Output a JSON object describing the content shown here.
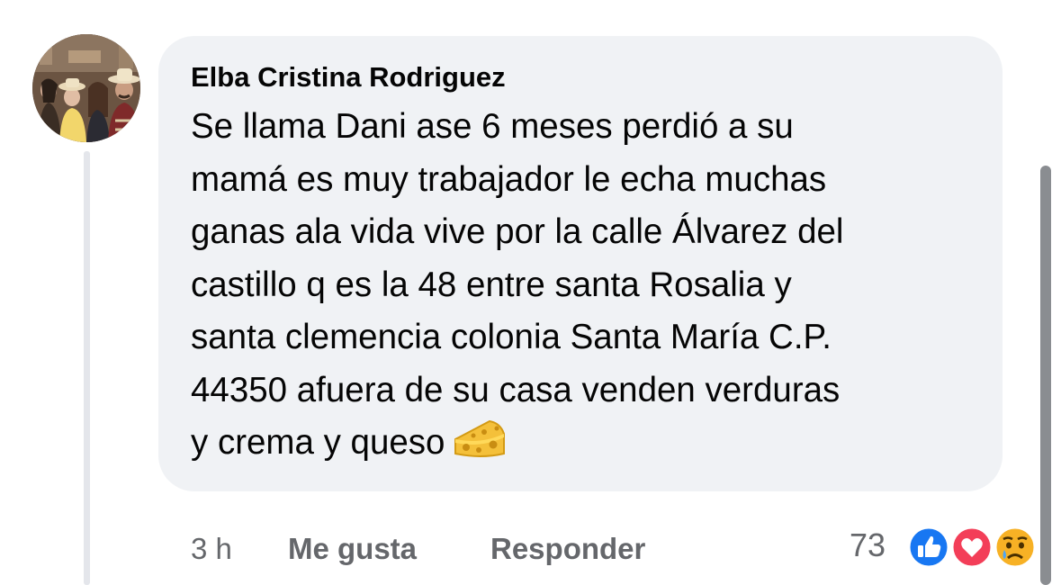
{
  "comment": {
    "author": "Elba Cristina Rodriguez",
    "text_lines": [
      "Se llama Dani ase 6 meses perdió a su",
      "mamá es muy trabajador le echa muchas",
      "ganas ala vida vive por la calle Álvarez del",
      "castillo q es la 48 entre santa Rosalia y",
      "santa clemencia colonia Santa María C.P.",
      "44350 afuera de su casa venden verduras",
      "y crema y queso"
    ],
    "emoji": "cheese-icon"
  },
  "actions": {
    "time": "3 h",
    "like_label": "Me gusta",
    "reply_label": "Responder"
  },
  "reactions": {
    "count": "73",
    "icons": [
      "like-reaction-icon",
      "love-reaction-icon",
      "sad-reaction-icon"
    ]
  },
  "colors": {
    "bubble": "#f0f2f5",
    "secondary_text": "#65676b",
    "like_blue": "#1877f2",
    "love_red": "#f33e58",
    "sad_yellow": "#f7b125"
  }
}
